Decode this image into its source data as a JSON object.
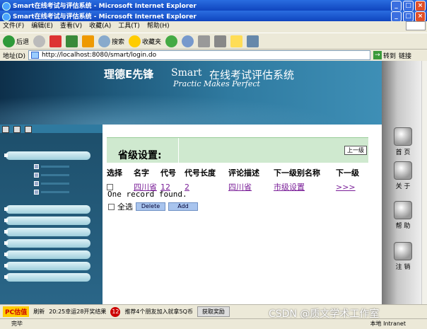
{
  "window": {
    "title_outer": "Smart在线考试与评估系统 - Microsoft Internet Explorer",
    "title_inner": "Smart在线考试与评估系统 - Microsoft Internet Explorer"
  },
  "menu": [
    "文件(F)",
    "编辑(E)",
    "查看(V)",
    "收藏(A)",
    "工具(T)",
    "帮助(H)"
  ],
  "toolbar": {
    "back": "后退",
    "search": "搜索",
    "favorites": "收藏夹"
  },
  "address": {
    "label": "地址(D)",
    "url": "http://localhost:8080/smart/login.do",
    "go": "转到",
    "links": "链接"
  },
  "banner": {
    "brand": "理德E先锋",
    "product": "Smart",
    "system": "在线考试评估系统",
    "slogan": "Practic Makes Perfect"
  },
  "right_nav": [
    "首 页",
    "关 于",
    "帮 助",
    "注 销"
  ],
  "panel": {
    "title": "省级设置:",
    "up_button": "上一级"
  },
  "table": {
    "headers": [
      "选择",
      "名字",
      "代号",
      "代号长度",
      "评论描述",
      "下一级别名称",
      "下一级"
    ],
    "rows": [
      {
        "name": "四川省",
        "code": "12",
        "code_length": "2",
        "description": "四川省",
        "next_level_name": "市级设置",
        "next": ">>>"
      }
    ]
  },
  "found_text": "One record found.",
  "actions": {
    "select_all": "全选",
    "delete": "Delete",
    "add": "Add"
  },
  "links_bar": {
    "pc": "PC估值",
    "refresh": "刷新",
    "news": "20:25幸运28开奖结果",
    "badge": "12",
    "promo": "推荐4个朋友加入就拿5Q币",
    "get": "获取奖励"
  },
  "watermark": "CSDN @质文学术工作室",
  "status": {
    "left": "完毕",
    "zone": "本地 Intranet"
  }
}
